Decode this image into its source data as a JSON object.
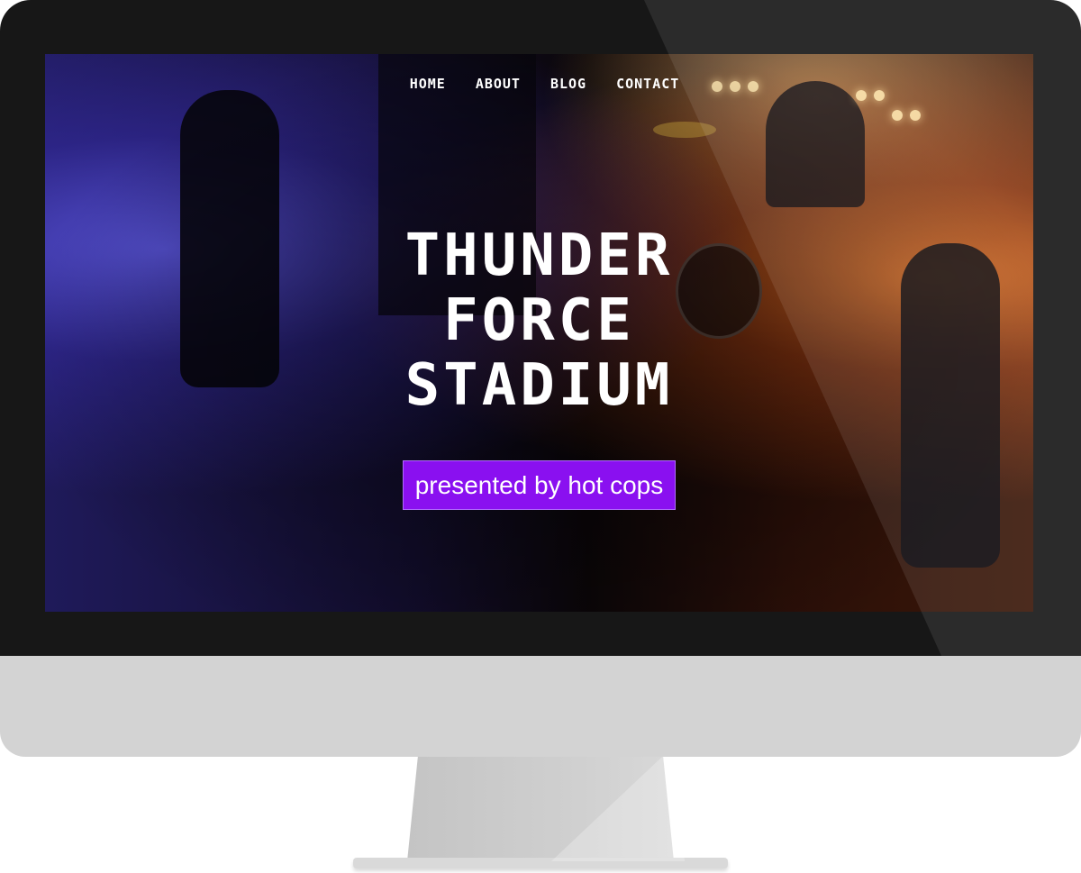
{
  "nav": {
    "items": [
      {
        "label": "HOME"
      },
      {
        "label": "ABOUT"
      },
      {
        "label": "BLOG"
      },
      {
        "label": "CONTACT"
      }
    ]
  },
  "hero": {
    "title_lines": [
      "THUNDER",
      "FORCE",
      "STADIUM"
    ],
    "cta_label": "presented by hot cops"
  },
  "colors": {
    "cta_background": "#8a10f0",
    "text": "#ffffff",
    "bezel": "#171717",
    "chin": "#d3d3d3"
  }
}
